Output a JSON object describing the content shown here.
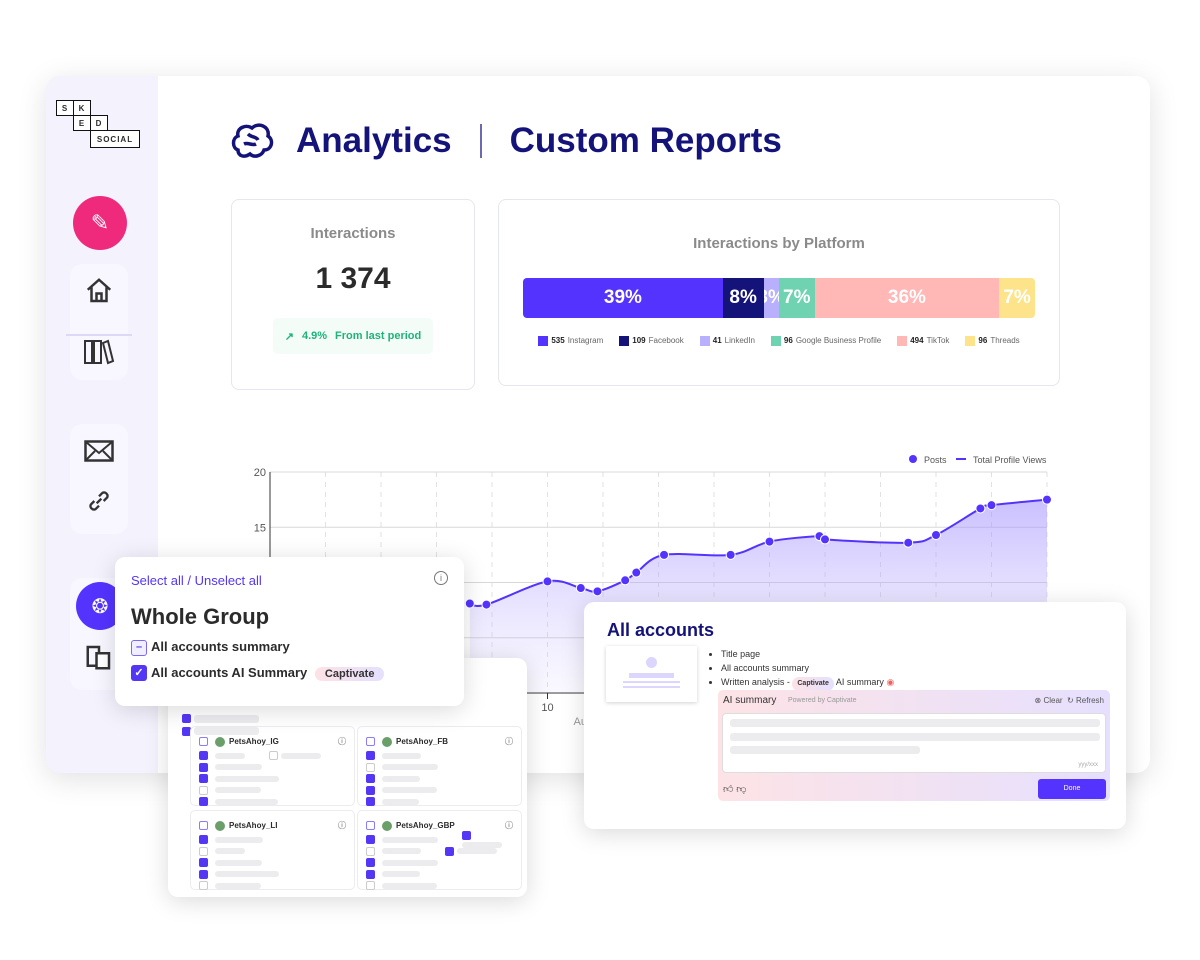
{
  "brand": {
    "logo_letters": [
      "S",
      "K",
      "E",
      "D",
      "SOCIAL"
    ]
  },
  "sidebar": {
    "items": [
      {
        "name": "create",
        "icon": "magic-pencil-icon"
      },
      {
        "name": "home",
        "icon": "home-icon"
      },
      {
        "name": "library",
        "icon": "library-icon"
      },
      {
        "name": "inbox",
        "icon": "envelope-icon"
      },
      {
        "name": "link-in-bio",
        "icon": "link-icon"
      },
      {
        "name": "analytics",
        "icon": "brain-icon"
      },
      {
        "name": "reports",
        "icon": "clipboard-icon"
      }
    ]
  },
  "header": {
    "section": "Analytics",
    "page": "Custom Reports"
  },
  "interactions_card": {
    "title": "Interactions",
    "value": "1 374",
    "change": "4.9%",
    "change_label": "From last period",
    "change_color": "#1db37a"
  },
  "platform_card": {
    "title": "Interactions by Platform",
    "segments": [
      {
        "label": "39%",
        "count": "535",
        "platform": "Instagram",
        "color": "#5433ff",
        "value": 535
      },
      {
        "label": "8%",
        "count": "109",
        "platform": "Facebook",
        "color": "#14137a",
        "value": 109
      },
      {
        "label": "3%",
        "count": "41",
        "platform": "LinkedIn",
        "color": "#b9b0fd",
        "value": 41
      },
      {
        "label": "7%",
        "count": "96",
        "platform": "Google Business Profile",
        "color": "#6fd3b1",
        "value": 96
      },
      {
        "label": "36%",
        "count": "494",
        "platform": "TikTok",
        "color": "#ffb8b5",
        "value": 494
      },
      {
        "label": "7%",
        "count": "96",
        "platform": "Threads",
        "color": "#fde48a",
        "value": 96
      }
    ]
  },
  "chart_data": {
    "type": "area",
    "legend": [
      {
        "label": "Posts",
        "marker": "dot"
      },
      {
        "label": "Total Profile Views",
        "marker": "line"
      }
    ],
    "legend_position": "top-right",
    "ylim": [
      0,
      20
    ],
    "yticks": [
      "20",
      "15"
    ],
    "xlim": [
      5,
      19
    ],
    "xticks": [
      {
        "x": 10,
        "label": "10"
      }
    ],
    "xlabel": "Au",
    "grid": true,
    "color": "#5433ff",
    "series": [
      {
        "x": [
          8.6,
          8.9,
          10,
          10.6,
          10.9,
          11.4,
          11.6,
          12.1,
          13.3,
          14.0,
          14.9,
          15.0,
          16.5,
          17.0,
          17.8,
          18.0,
          19.0
        ],
        "y": [
          8.1,
          8.0,
          10.1,
          9.5,
          9.2,
          10.2,
          10.9,
          12.5,
          12.5,
          13.7,
          14.2,
          13.9,
          13.6,
          14.3,
          16.7,
          17.0,
          17.5
        ]
      }
    ]
  },
  "select_popup": {
    "select_all": "Select all",
    "divider": " / ",
    "unselect_all": "Unselect all",
    "group_title": "Whole Group",
    "options": [
      {
        "label": "All accounts summary",
        "state": "indeterminate"
      },
      {
        "label": "All accounts AI Summary",
        "state": "checked",
        "badge": "Captivate"
      }
    ]
  },
  "accounts_panel": {
    "accounts": [
      {
        "name": "PetsAhoy_IG",
        "checks": [
          true,
          true,
          true,
          false,
          true
        ],
        "extra": [
          false
        ]
      },
      {
        "name": "PetsAhoy_FB",
        "checks": [
          true,
          false,
          true,
          true,
          true
        ],
        "extra": []
      },
      {
        "name": "PetsAhoy_LI",
        "checks": [
          true,
          false,
          true,
          true,
          false
        ],
        "extra": []
      },
      {
        "name": "PetsAhoy_GBP",
        "checks": [
          true,
          false,
          true,
          true,
          false
        ],
        "extra": [
          true,
          true
        ]
      }
    ]
  },
  "report_card": {
    "title": "All accounts",
    "items": [
      "Title page",
      "All accounts summary",
      "Written analysis -"
    ],
    "badge": "Captivate",
    "after_badge": "AI summary",
    "ai_box": {
      "title": "AI summary",
      "powered": "Powered by Captivate",
      "clear": "Clear",
      "refresh": "Refresh",
      "counter": "yyy/xxx",
      "done": "Done"
    }
  }
}
